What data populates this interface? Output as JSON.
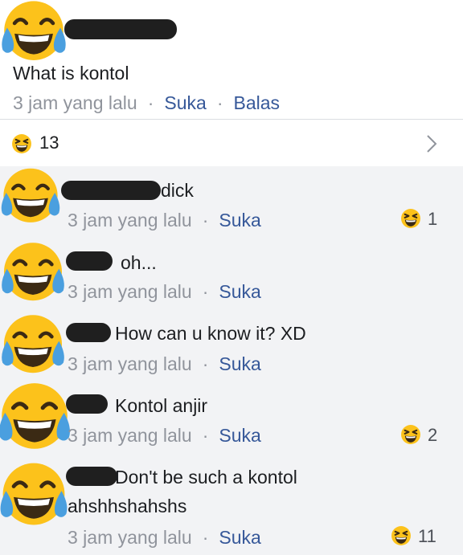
{
  "post": {
    "text": "What is kontol",
    "time": "3 jam yang lalu",
    "like_label": "Suka",
    "reply_label": "Balas"
  },
  "reaction_summary": {
    "icon": "laughing-emoji-icon",
    "count": "13"
  },
  "replies": [
    {
      "text": "dick",
      "time": "3 jam yang lalu",
      "like_label": "Suka",
      "reactions": "1"
    },
    {
      "text": "oh...",
      "time": "3 jam yang lalu",
      "like_label": "Suka",
      "reactions": ""
    },
    {
      "text": "How can u know it? XD",
      "time": "3 jam yang lalu",
      "like_label": "Suka",
      "reactions": ""
    },
    {
      "text": "Kontol anjir",
      "time": "3 jam yang lalu",
      "like_label": "Suka",
      "reactions": "2"
    },
    {
      "text": "Don't be such a kontol",
      "text2": "ahshhshahshs",
      "time": "3 jam yang lalu",
      "like_label": "Suka",
      "reactions": "11"
    }
  ],
  "colors": {
    "link": "#365899",
    "meta": "#90949c",
    "reply_bg": "#f2f3f5",
    "emoji_yellow": "#fcc21b",
    "tear_blue": "#4a9fdf"
  }
}
